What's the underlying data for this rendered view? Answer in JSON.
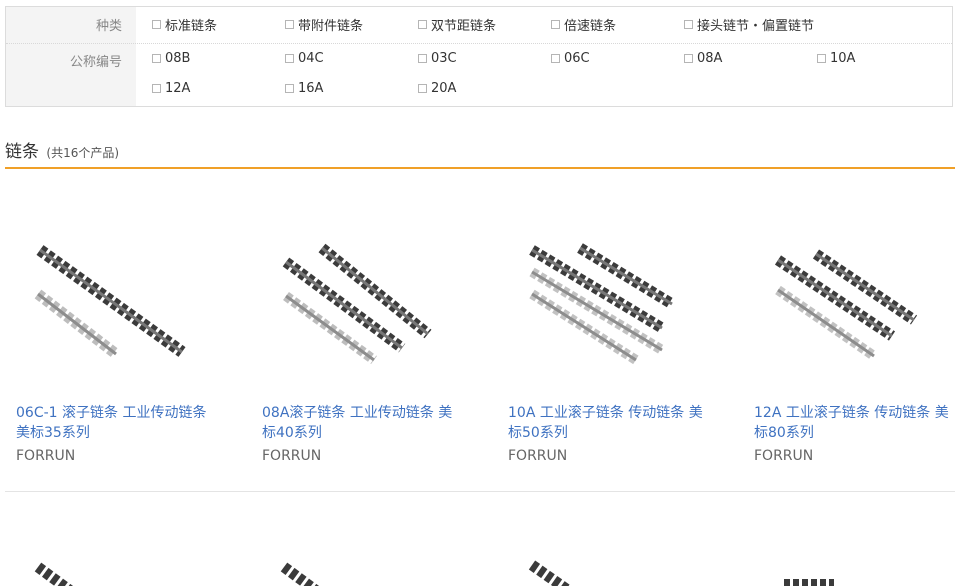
{
  "filters": {
    "type_label": "种类",
    "type_options": [
      "标准链条",
      "带附件链条",
      "双节距链条",
      "倍速链条",
      "接头链节・偏置链节"
    ],
    "code_label": "公称编号",
    "code_options": [
      "08B",
      "04C",
      "03C",
      "06C",
      "08A",
      "10A",
      "12A",
      "16A",
      "20A"
    ]
  },
  "section": {
    "title": "链条",
    "count": "(共16个产品)"
  },
  "products": [
    {
      "title": "06C-1 滚子链条 工业传动链条 美标35系列",
      "brand": "FORRUN"
    },
    {
      "title": "08A滚子链条 工业传动链条 美标40系列",
      "brand": "FORRUN"
    },
    {
      "title": "10A 工业滚子链条 传动链条 美标50系列",
      "brand": "FORRUN"
    },
    {
      "title": "12A 工业滚子链条 传动链条 美标80系列",
      "brand": "FORRUN"
    }
  ],
  "colors": {
    "accent": "#f0a028",
    "link": "#3f72c1",
    "chain_dark": "#3b3b3b",
    "chain_light": "#bdbdbd"
  }
}
